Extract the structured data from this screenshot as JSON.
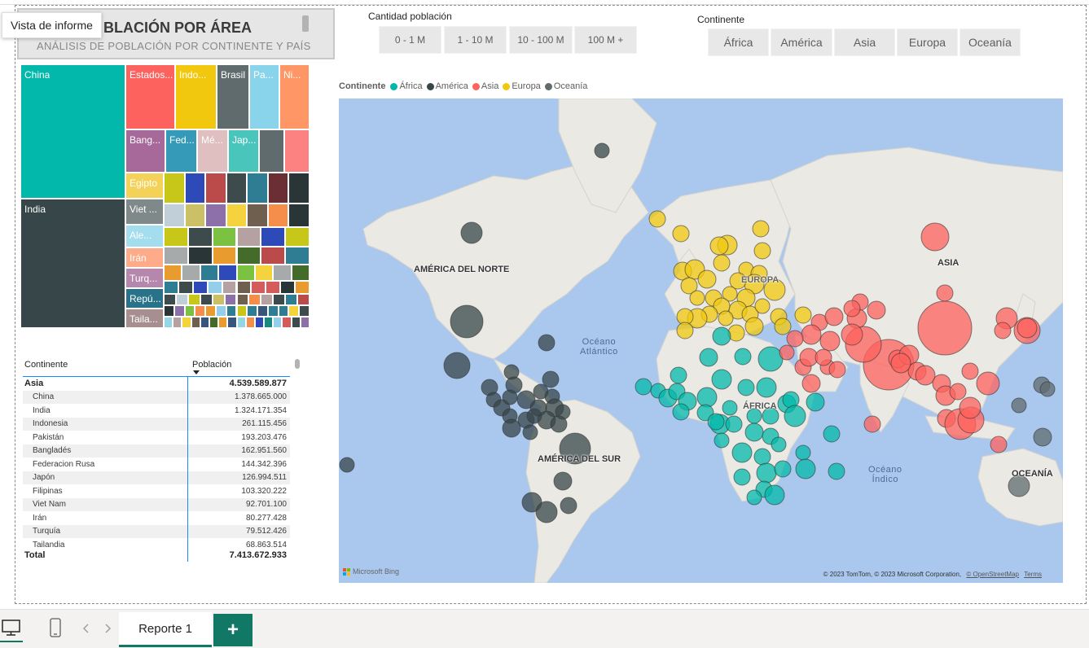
{
  "tooltip": "Vista de informe",
  "title": {
    "main": "BLACIÓN POR ÁREA",
    "sub": "ANÁLISIS DE POBLACIÓN POR CONTINENTE Y PAÍS"
  },
  "slicer_population": {
    "title": "Cantidad población",
    "options": [
      "0 - 1 M",
      "1 - 10 M",
      "10 - 100 M",
      "100 M +"
    ]
  },
  "slicer_continent": {
    "title": "Continente",
    "options": [
      "África",
      "América",
      "Asia",
      "Europa",
      "Oceanía"
    ]
  },
  "colors": {
    "africa": "#01b8aa",
    "america": "#374649",
    "asia": "#fd625e",
    "europa": "#f2c80f",
    "oceania": "#5f6b6d",
    "accent": "#117865"
  },
  "treemap": {
    "labeled": [
      "China",
      "India",
      "Estados...",
      "Indo...",
      "Brasil",
      "Pa...",
      "Ni...",
      "Bang...",
      "Fed...",
      "Mé...",
      "Jap...",
      "Egipto",
      "Viet ...",
      "Ale...",
      "Irán",
      "Turq...",
      "Repú...",
      "Taila..."
    ]
  },
  "table": {
    "headers": [
      "Continente",
      "Población"
    ],
    "group": {
      "name": "Asia",
      "value": "4.539.589.877"
    },
    "rows": [
      {
        "name": "China",
        "value": "1.378.665.000"
      },
      {
        "name": "India",
        "value": "1.324.171.354"
      },
      {
        "name": "Indonesia",
        "value": "261.115.456"
      },
      {
        "name": "Pakistán",
        "value": "193.203.476"
      },
      {
        "name": "Bangladés",
        "value": "162.951.560"
      },
      {
        "name": "Federacion Rusa",
        "value": "144.342.396"
      },
      {
        "name": "Japón",
        "value": "126.994.511"
      },
      {
        "name": "Filipinas",
        "value": "103.320.222"
      },
      {
        "name": "Viet Nam",
        "value": "92.701.100"
      },
      {
        "name": "Irán",
        "value": "80.277.428"
      },
      {
        "name": "Turquía",
        "value": "79.512.426"
      },
      {
        "name": "Tailandia",
        "value": "68.863.514"
      }
    ],
    "total": {
      "name": "Total",
      "value": "7.413.672.933"
    }
  },
  "map": {
    "legend_title": "Continente",
    "legend": [
      "África",
      "América",
      "Asia",
      "Europa",
      "Oceanía"
    ],
    "labels": {
      "na": "AMÉRICA DEL NORTE",
      "sa": "AMÉRICA DEL SUR",
      "eu": "EUROPA",
      "af": "ÁFRICA",
      "as": "ASIA",
      "oc": "OCEANÍA"
    },
    "oceans": {
      "atl1": "Océano",
      "atl2": "Atlántico",
      "ind1": "Océano",
      "ind2": "Índico"
    },
    "attribution": "Microsoft Bing",
    "copyright": "© 2023 TomTom, © 2023 Microsoft Corporation,",
    "osm": "© OpenStreetMap",
    "terms": "Terms"
  },
  "bottom": {
    "page_tab": "Reporte 1",
    "add_label": "+"
  }
}
